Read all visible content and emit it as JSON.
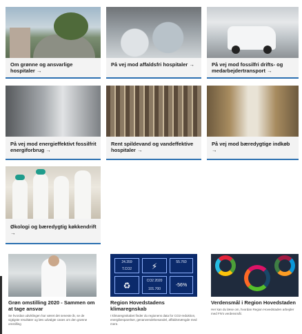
{
  "cards": [
    {
      "label": "Om grønne og ansvarlige hospitaler",
      "arrow": "→"
    },
    {
      "label": "På vej mod affaldsfri hospitaler",
      "arrow": "→"
    },
    {
      "label": "På vej mod fossilfri drifts- og medarbejdertransport",
      "arrow": "→"
    },
    {
      "label": "På vej mod energieffektivt fossilfrit energiforbrug",
      "arrow": "→"
    },
    {
      "label": "Rent spildevand og vandeffektive hospitaler",
      "arrow": "→"
    },
    {
      "label": "På vej mod bæredygtige indkøb",
      "arrow": "→"
    },
    {
      "label": "Økologi og bæredygtig køkkendrift",
      "arrow": "→"
    }
  ],
  "bottom": [
    {
      "title": "Grøn omstilling 2020 - Sammen om at tage ansvar",
      "desc": "Se hvordan udviklingen har været det seneste år, se de vigtigste resultater og læs udvalgte cases om den grønne omstilling"
    },
    {
      "title": "Region Hovedstadens klimaregnskab",
      "desc": "I klimaregnskabet finder du regionens data for CO2-reduktion, energibesparelser, genanvendelsesandel, affaldsmængde med mere.",
      "tiles": [
        "24.359",
        "T.CO2",
        "55.760",
        "CO2 2020",
        "101.700",
        "-56%"
      ]
    },
    {
      "title": "Verdensmål i Region Hovedstaden",
      "desc": "Her kan du læse om, hvordan Region Hovedstaden arbejder med FN's verdensmål."
    }
  ],
  "colors": {
    "accent": "#2a6fb0",
    "card_bg": "#f3f3f3",
    "sdg_blue": "#0b2a6b"
  }
}
